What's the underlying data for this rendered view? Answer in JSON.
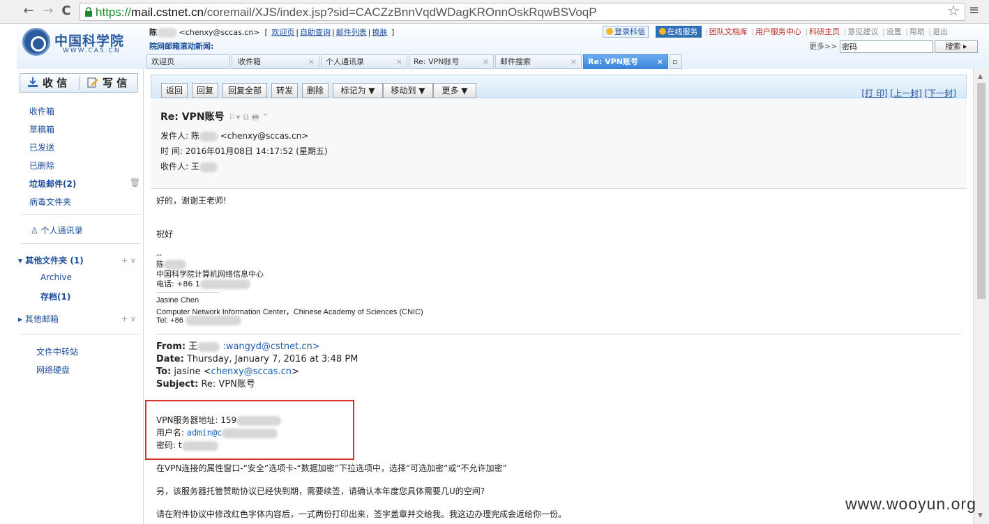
{
  "browser": {
    "back_icon": "←",
    "forward_icon": "→",
    "reload_icon": "C",
    "url_scheme": "https://",
    "url_host": "mail.cstnet.cn",
    "url_path": "/coremail/XJS/index.jsp?sid=CACZzBnnVqdWDagKROnnOskRqwBSVoqP",
    "star_icon": "☆",
    "menu_icon": "≡"
  },
  "header": {
    "logo_cn": "中国科学院",
    "logo_en": "WWW.CAS.CN",
    "user_name": "陈",
    "user_email": "<chenxy@sccas.cn>",
    "bracket_open": "[",
    "bracket_close": "]",
    "user_links": [
      "欢迎页",
      "自助查询",
      "邮件列表",
      "换肤"
    ],
    "news": "院网邮箱滚动新闻:",
    "pill_login": "登录科信",
    "pill_online": "在线服务",
    "red_links": [
      "团队文档库",
      "用户服务中心",
      "科研主页"
    ],
    "gray_links": [
      "意见建议",
      "设置",
      "帮助",
      "退出"
    ],
    "more_label": "更多>>",
    "search_value": "密码",
    "search_button": "搜索 ▸"
  },
  "tabs": [
    {
      "label": "欢迎页",
      "close": ""
    },
    {
      "label": "收件箱",
      "close": "×"
    },
    {
      "label": "个人通讯录",
      "close": "×"
    },
    {
      "label": "Re: VPN账号",
      "close": "×"
    },
    {
      "label": "邮件搜索",
      "close": "×"
    },
    {
      "label": "Re: VPN账号",
      "close": "×"
    }
  ],
  "sidebar": {
    "receive": "收 信",
    "compose": "写 信",
    "folders": [
      "收件箱",
      "草稿箱",
      "已发送",
      "已删除",
      "垃圾邮件(2)",
      "病毒文件夹"
    ],
    "contacts": "个人通讯录",
    "other_folders": "其他文件夹 (1)",
    "sub_folders": [
      "Archive",
      "存档(1)"
    ],
    "other_mailbox": "其他邮箱",
    "plus_v": "+ ∨",
    "extras": [
      "文件中转站",
      "网络硬盘"
    ]
  },
  "toolbar": {
    "buttons": [
      "返回",
      "回复",
      "回复全部",
      "转发",
      "删除",
      "标记为 ▼",
      "移动到 ▼",
      "更多 ▼"
    ],
    "print": "[打 印]",
    "prev": "[上一封]",
    "next": "[下一封]"
  },
  "mail": {
    "subject": "Re:  VPN账号",
    "from_label": "发件人:",
    "from_name": "陈",
    "from_email": "<chenxy@sccas.cn>",
    "time_label": "时   间:",
    "time_value": "2016年01月08日 14:17:52 (星期五)",
    "to_label": "收件人:",
    "to_name": "王",
    "greeting": "好的，谢谢王老师!",
    "regards": "祝好",
    "sig_dashes": "--",
    "sig_name": "陈",
    "sig_org": "中国科学院计算机网络信息中心",
    "sig_phone": "电话: +86 1",
    "sig_en_name": "Jasine Chen",
    "sig_en_org": "Computer Network Information Center，Chinese Academy of Sciences (CNIC)",
    "sig_en_tel": "Tel:  +86",
    "q_from_label": "From:",
    "q_from_name": "王",
    "q_from_email": ":wangyd@cstnet.cn>",
    "q_date_label": "Date:",
    "q_date": "Thursday, January 7, 2016 at 3:48 PM",
    "q_to_label": "To:",
    "q_to": "jasine <",
    "q_to_email": "chenxy@sccas.cn",
    "q_to_close": ">",
    "q_subj_label": "Subject:",
    "q_subj": "Re: VPN账号",
    "vpn_addr": "VPN服务器地址: 159",
    "vpn_user_label": "用户名: ",
    "vpn_user": "admin@c",
    "vpn_pwd": "密码: t",
    "para1": "在VPN连接的属性窗口-“安全”选项卡-“数据加密”下拉选项中，选择“可选加密”或“不允许加密”",
    "para2": "另，该服务器托管赞助协议已经快到期，需要续签，请确认本年度您具体需要几U的空间?",
    "para3": "请在附件协议中修改红色字体内容后，一式两份打印出来，签字盖章并交给我。我这边办理完成会返给你一份。"
  },
  "watermark": "www.wooyun.org"
}
